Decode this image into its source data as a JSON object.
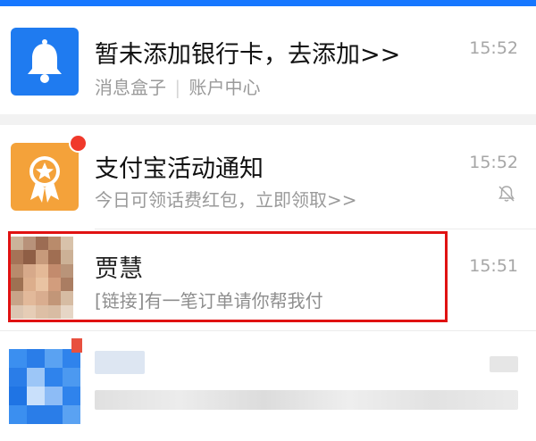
{
  "messages": [
    {
      "title": "暂未添加银行卡，去添加>>",
      "sub_left": "消息盒子",
      "sub_sep": "|",
      "sub_right": "账户中心",
      "time": "15:52",
      "icon": "bell-icon",
      "icon_color": "#1f7bf0"
    },
    {
      "title": "支付宝活动通知",
      "subtitle": "今日可领话费红包，立即领取>>",
      "time": "15:52",
      "icon": "star-medal-icon",
      "icon_color": "#f4a23a",
      "badge": "red-dot",
      "muted_icon": "bell-off-icon"
    },
    {
      "title": "贾慧",
      "subtitle": "[链接]有一笔订单请你帮我付",
      "time": "15:51",
      "icon": "pixelated-avatar-icon",
      "highlight_color": "#e01212"
    },
    {
      "icon": "pixelated-blue-icon",
      "badge": "red-square"
    }
  ],
  "colors": {
    "accent": "#1677ff",
    "badge_red": "#f0392b"
  }
}
